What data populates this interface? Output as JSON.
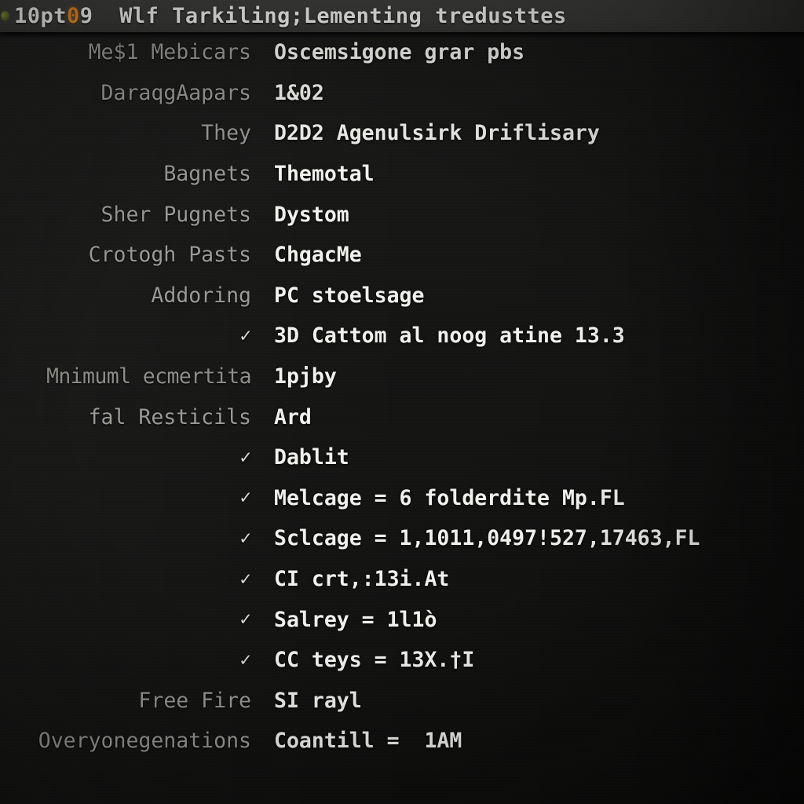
{
  "titlebar": {
    "status_icon": "status-dot-icon",
    "title_prefix": "10pt",
    "title_highlight": "0",
    "title_suffix": "9  Wlf Tarkiling;Lementing tredusttes",
    "accent_color": "#e08a2e",
    "background_color": "#3a3a38"
  },
  "colors": {
    "key_text": "#9a9a96",
    "value_text": "#f0f0ec",
    "body_background": "#151514",
    "check_mark": "#d8d8d4"
  },
  "rows": [
    {
      "key": "Me$1 Mebicars",
      "value": "Oscemsigone grar pbs",
      "checked": false,
      "blurred": false
    },
    {
      "key": "DaraqgAapars",
      "value": "1&02",
      "checked": false,
      "blurred": false
    },
    {
      "key": "They",
      "value": "D2D2 Agenulsirk Driflisary",
      "checked": false,
      "blurred": false
    },
    {
      "key": "Bagnets",
      "value": "Themotal",
      "checked": false,
      "blurred": false
    },
    {
      "key": "Sher Pugnets",
      "value": "Dystom",
      "checked": false,
      "blurred": false
    },
    {
      "key": "Crotogh Pasts",
      "value": "ChgacMe",
      "checked": false,
      "blurred": false
    },
    {
      "key": "Addoring",
      "value": "PC stoelsage",
      "checked": false,
      "blurred": false
    },
    {
      "key": "",
      "value": "3D Cattom al noog atine 13.3",
      "checked": true,
      "blurred": false
    },
    {
      "key": "Mnimuml ecmertita",
      "value": "1pjby",
      "checked": false,
      "blurred": true
    },
    {
      "key": "fal Resticils",
      "value": "Ard",
      "checked": false,
      "blurred": false
    },
    {
      "key": "",
      "value": "Dablit",
      "checked": true,
      "blurred": false
    },
    {
      "key": "",
      "value": "Melcage = 6 folderdite Mp.FL",
      "checked": true,
      "blurred": false
    },
    {
      "key": "",
      "value": "Sclcage = 1,1011,0497!527,17463,FL",
      "checked": true,
      "blurred": false
    },
    {
      "key": "",
      "value": "CI crt,:13i.At",
      "checked": true,
      "blurred": false
    },
    {
      "key": "",
      "value": "Salrey = 1l1ò",
      "checked": true,
      "blurred": false
    },
    {
      "key": "",
      "value": "CC teys = 13X.†I",
      "checked": true,
      "blurred": false
    },
    {
      "key": "Free Fire",
      "value": "SI rayl",
      "checked": false,
      "blurred": false
    },
    {
      "key": "Overyonegenations",
      "value": "Coantill =  1AM",
      "checked": false,
      "blurred": false
    }
  ],
  "check_glyph": "✓"
}
